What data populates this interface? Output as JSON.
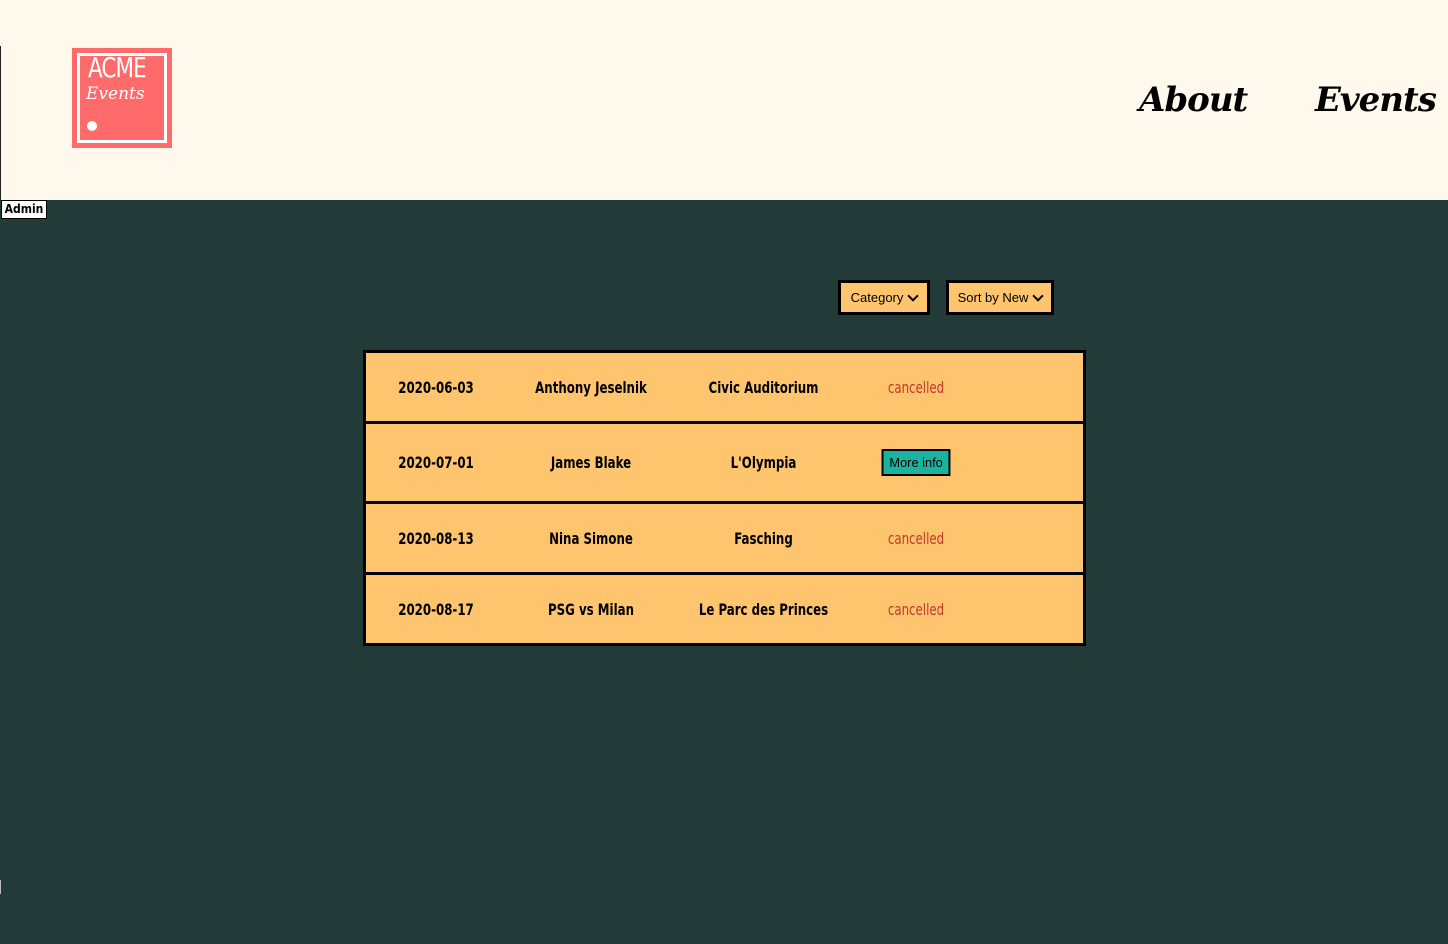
{
  "header": {
    "logo": {
      "title": "ACME",
      "subtitle": "Events"
    },
    "nav": [
      {
        "label": "About"
      },
      {
        "label": "Events"
      }
    ]
  },
  "admin": {
    "label": "Admin"
  },
  "filters": {
    "category": {
      "selected": "Category"
    },
    "sort": {
      "selected": "Sort by New"
    }
  },
  "events": [
    {
      "date": "2020-06-03",
      "name": "Anthony Jeselnik",
      "venue": "Civic Auditorium",
      "status": "cancelled"
    },
    {
      "date": "2020-07-01",
      "name": "James Blake",
      "venue": "L'Olympia",
      "action": "More info"
    },
    {
      "date": "2020-08-13",
      "name": "Nina Simone",
      "venue": "Fasching",
      "status": "cancelled"
    },
    {
      "date": "2020-08-17",
      "name": "PSG vs Milan",
      "venue": "Le Parc des Princes",
      "status": "cancelled"
    }
  ],
  "colors": {
    "header_bg": "#fff8ec",
    "page_bg": "#223a38",
    "logo_bg": "#ff6b6b",
    "row_bg": "#ffc56e",
    "cancelled_text": "#c0392b",
    "button_bg": "#19b3a0"
  }
}
